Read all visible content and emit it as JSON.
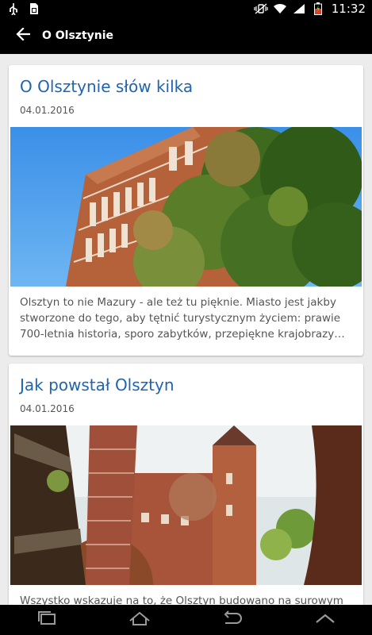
{
  "status_bar": {
    "time": "11:32",
    "icons": [
      "usb-icon",
      "sim-storage-icon",
      "vibrate-mute-icon",
      "wifi-icon",
      "signal-icon",
      "battery-charging-icon"
    ]
  },
  "app_bar": {
    "title": "O Olsztynie",
    "back_icon": "arrow-back-icon"
  },
  "articles": [
    {
      "title": "O Olsztynie słów kilka",
      "date": "04.01.2016",
      "image": "brick-cathedral-tower-with-tree",
      "excerpt": "Olsztyn to nie Mazury - ale też tu pięknie. Miasto jest jakby stworzone do tego, aby tętnić turystycznym życiem: prawie 700-letnia historia, sporo zabytków, przepiękne krajobrazy…"
    },
    {
      "title": "Jak powstał Olsztyn",
      "date": "04.01.2016",
      "image": "castle-tower-through-window-fisheye",
      "excerpt": "Wszystko wskazuje na to, że Olsztyn budowano na surowym"
    }
  ],
  "nav_bar": {
    "icons": [
      "recent-apps-icon",
      "home-icon",
      "back-icon",
      "menu-up-icon"
    ]
  },
  "colors": {
    "title_blue": "#1e64b0",
    "bar_black": "#000000",
    "background": "#ececec"
  }
}
